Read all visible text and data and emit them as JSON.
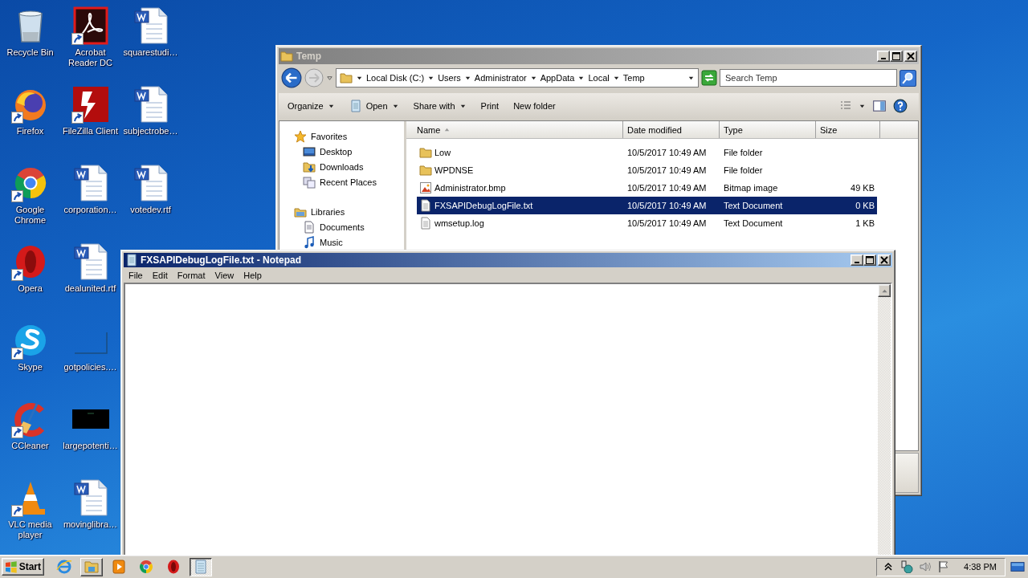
{
  "desktop": {
    "icons": [
      {
        "label": "Recycle Bin",
        "kind": "recycle",
        "shortcut": false
      },
      {
        "label": "Firefox",
        "kind": "firefox",
        "shortcut": true
      },
      {
        "label": "Google Chrome",
        "kind": "chrome",
        "shortcut": true
      },
      {
        "label": "Opera",
        "kind": "opera",
        "shortcut": true
      },
      {
        "label": "Skype",
        "kind": "skype",
        "shortcut": true
      },
      {
        "label": "CCleaner",
        "kind": "ccleaner",
        "shortcut": true
      },
      {
        "label": "VLC media player",
        "kind": "vlc",
        "shortcut": true
      },
      {
        "label": "Acrobat Reader DC",
        "kind": "acrobat",
        "shortcut": true
      },
      {
        "label": "FileZilla Client",
        "kind": "filezilla",
        "shortcut": true
      },
      {
        "label": "corporation…",
        "kind": "word",
        "shortcut": false
      },
      {
        "label": "dealunited.rtf",
        "kind": "word",
        "shortcut": false
      },
      {
        "label": "gotpolicies.…",
        "kind": "blank",
        "shortcut": false
      },
      {
        "label": "largepotenti…",
        "kind": "dark",
        "shortcut": false
      },
      {
        "label": "movinglibra…",
        "kind": "word",
        "shortcut": false
      },
      {
        "label": "squarestudi…",
        "kind": "word",
        "shortcut": false
      },
      {
        "label": "subjectrobe…",
        "kind": "word",
        "shortcut": false
      },
      {
        "label": "votedev.rtf",
        "kind": "word",
        "shortcut": false
      }
    ]
  },
  "explorer": {
    "title": "Temp",
    "address": [
      "Local Disk (C:)",
      "Users",
      "Administrator",
      "AppData",
      "Local",
      "Temp"
    ],
    "search_placeholder": "Search Temp",
    "toolbar": [
      {
        "label": "Organize",
        "kind": "plain",
        "dropdown": true
      },
      {
        "label": "Open",
        "kind": "document",
        "dropdown": true
      },
      {
        "label": "Share with",
        "kind": "plain",
        "dropdown": true
      },
      {
        "label": "Print",
        "kind": "plain",
        "dropdown": false
      },
      {
        "label": "New folder",
        "kind": "plain",
        "dropdown": false
      }
    ],
    "navigation": [
      {
        "label": "Favorites",
        "kind": "star",
        "children": [
          {
            "label": "Desktop",
            "kind": "desktop"
          },
          {
            "label": "Downloads",
            "kind": "downloads"
          },
          {
            "label": "Recent Places",
            "kind": "recent"
          }
        ]
      },
      {
        "label": "Libraries",
        "kind": "libraries",
        "children": [
          {
            "label": "Documents",
            "kind": "documents"
          },
          {
            "label": "Music",
            "kind": "music"
          }
        ]
      }
    ],
    "columns": [
      {
        "label": "Name",
        "sorted": true
      },
      {
        "label": "Date modified",
        "sorted": false
      },
      {
        "label": "Type",
        "sorted": false
      },
      {
        "label": "Size",
        "sorted": false
      }
    ],
    "files": [
      {
        "name": "Low",
        "date": "10/5/2017 10:49 AM",
        "type": "File folder",
        "kind": "folder",
        "selected": false
      },
      {
        "name": "WPDNSE",
        "date": "10/5/2017 10:49 AM",
        "type": "File folder",
        "kind": "folder",
        "selected": false
      },
      {
        "name": "Administrator.bmp",
        "date": "10/5/2017 10:49 AM",
        "type": "Bitmap image",
        "size": "49 KB",
        "kind": "bitmap",
        "selected": false
      },
      {
        "name": "FXSAPIDebugLogFile.txt",
        "date": "10/5/2017 10:49 AM",
        "type": "Text Document",
        "size": "0 KB",
        "kind": "text",
        "selected": true
      },
      {
        "name": "wmsetup.log",
        "date": "10/5/2017 10:49 AM",
        "type": "Text Document",
        "size": "1 KB",
        "kind": "text",
        "selected": false
      }
    ]
  },
  "notepad": {
    "title": "FXSAPIDebugLogFile.txt - Notepad",
    "menu": [
      "File",
      "Edit",
      "Format",
      "View",
      "Help"
    ]
  },
  "taskbar": {
    "start": "Start",
    "buttons": [
      {
        "kind": "ie",
        "open": false,
        "active": false
      },
      {
        "kind": "explorer",
        "open": true,
        "active": false
      },
      {
        "kind": "media",
        "open": false,
        "active": false
      },
      {
        "kind": "chrome",
        "open": false,
        "active": false
      },
      {
        "kind": "opera",
        "open": false,
        "active": false
      },
      {
        "kind": "notepad",
        "open": true,
        "active": true
      }
    ],
    "tray": [
      {
        "kind": "chevron"
      },
      {
        "kind": "network"
      },
      {
        "kind": "volume"
      },
      {
        "kind": "flag"
      }
    ],
    "time": "4:38 PM"
  }
}
